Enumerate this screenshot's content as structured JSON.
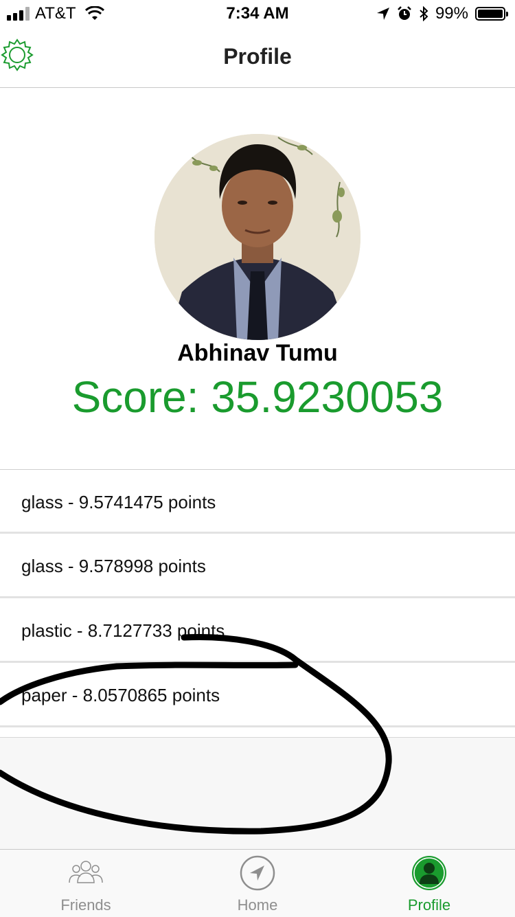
{
  "status_bar": {
    "carrier": "AT&T",
    "time": "7:34 AM",
    "battery_percent": "99%",
    "battery_level": 0.99,
    "icons": [
      "signal-icon",
      "wifi-icon",
      "location-arrow-icon",
      "alarm-icon",
      "bluetooth-icon",
      "battery-icon"
    ]
  },
  "nav": {
    "title": "Profile",
    "settings_icon": "gear-icon"
  },
  "profile": {
    "name": "Abhinav Tumu",
    "score_text": "Score: 35.9230053",
    "avatar_icon": "profile-photo"
  },
  "items": [
    {
      "label": "glass - 9.5741475 points"
    },
    {
      "label": "glass - 9.578998 points"
    },
    {
      "label": "plastic - 8.7127733 points"
    },
    {
      "label": "paper - 8.0570865 points"
    }
  ],
  "tabs": [
    {
      "label": "Friends",
      "icon": "friends-icon",
      "active": false
    },
    {
      "label": "Home",
      "icon": "navigation-arrow-icon",
      "active": false
    },
    {
      "label": "Profile",
      "icon": "person-icon",
      "active": true
    }
  ],
  "colors": {
    "accent": "#1a9b2e",
    "inactive_tab": "#8e8e8e"
  }
}
